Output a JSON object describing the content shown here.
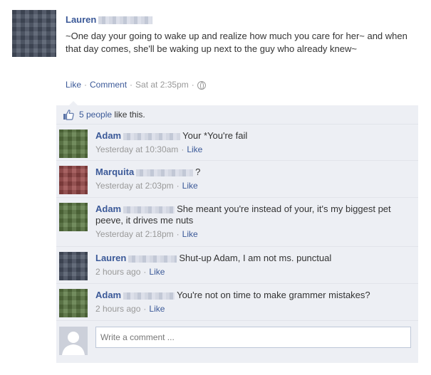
{
  "post": {
    "author": "Lauren",
    "text": "~One day your going to wake up and realize how much you care for her~ and when that day comes, she'll be waking up next to the guy who already knew~",
    "actions": {
      "like": "Like",
      "comment": "Comment",
      "time": "Sat at 2:35pm"
    }
  },
  "likes": {
    "count_link": "5 people",
    "suffix": " like this."
  },
  "comments": [
    {
      "author": "Adam",
      "text": "Your *You're fail",
      "time": "Yesterday at 10:30am",
      "like": "Like"
    },
    {
      "author": "Marquita",
      "text": "?",
      "time": "Yesterday at 2:03pm",
      "like": "Like"
    },
    {
      "author": "Adam",
      "text": "She meant you're instead of your, it's my biggest pet peeve, it drives me nuts",
      "time": "Yesterday at 2:18pm",
      "like": "Like"
    },
    {
      "author": "Lauren",
      "text": "Shut-up Adam, I am not ms. punctual",
      "time": "2 hours ago",
      "like": "Like"
    },
    {
      "author": "Adam",
      "text": "You're not on time to make grammer mistakes?",
      "time": "2 hours ago",
      "like": "Like"
    }
  ],
  "write_comment": {
    "placeholder": "Write a comment ..."
  },
  "colors": {
    "link": "#3b5998",
    "panel": "#edeff4",
    "meta": "#999999"
  },
  "icons": [
    "thumbs-up-icon",
    "globe-icon",
    "default-avatar-icon"
  ]
}
